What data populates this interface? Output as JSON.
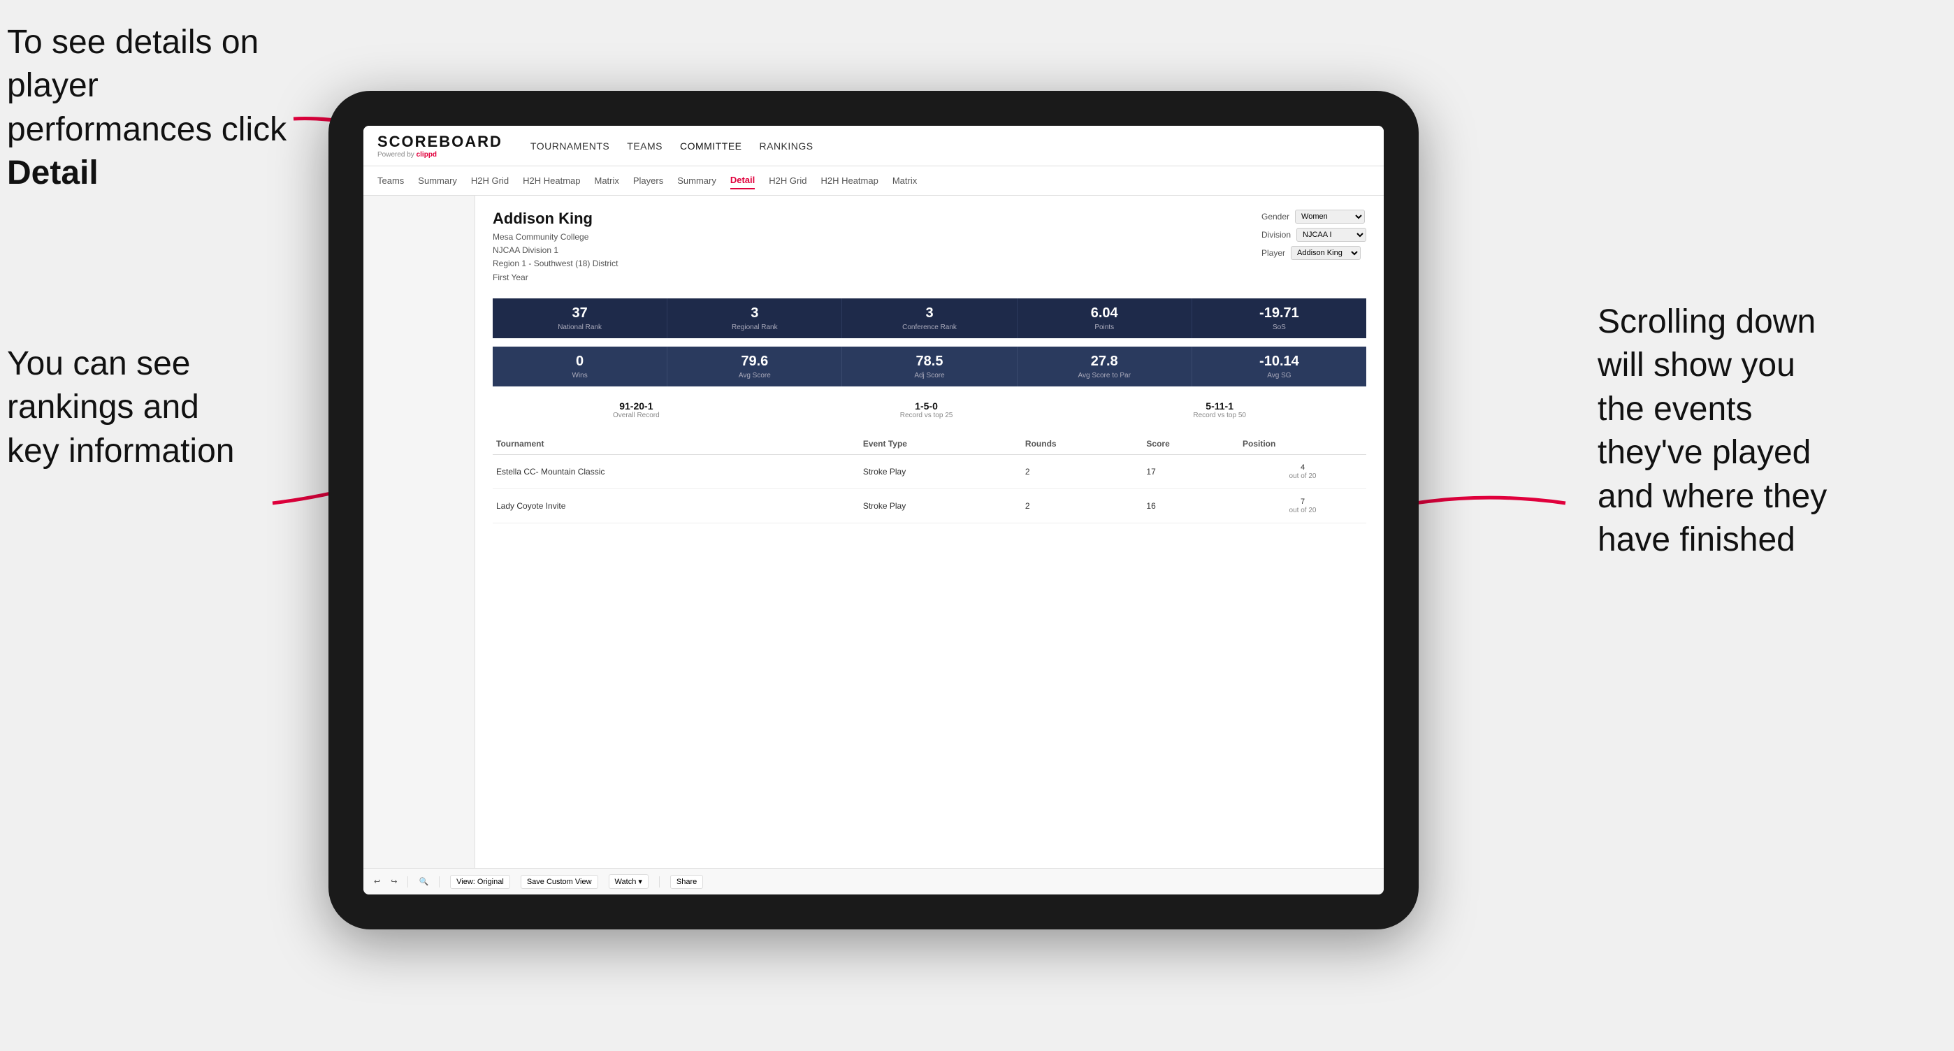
{
  "annotations": {
    "top_left": "To see details on player performances click ",
    "top_left_bold": "Detail",
    "bottom_left_line1": "You can see",
    "bottom_left_line2": "rankings and",
    "bottom_left_line3": "key information",
    "right_line1": "Scrolling down",
    "right_line2": "will show you",
    "right_line3": "the events",
    "right_line4": "they've played",
    "right_line5": "and where they",
    "right_line6": "have finished"
  },
  "nav": {
    "logo": "SCOREBOARD",
    "powered_by": "Powered by",
    "brand": "clippd",
    "items": [
      "TOURNAMENTS",
      "TEAMS",
      "COMMITTEE",
      "RANKINGS"
    ]
  },
  "sub_nav": {
    "items": [
      "Teams",
      "Summary",
      "H2H Grid",
      "H2H Heatmap",
      "Matrix",
      "Players",
      "Summary",
      "Detail",
      "H2H Grid",
      "H2H Heatmap",
      "Matrix"
    ],
    "active": "Detail"
  },
  "player": {
    "name": "Addison King",
    "school": "Mesa Community College",
    "division": "NJCAA Division 1",
    "region": "Region 1 - Southwest (18) District",
    "year": "First Year"
  },
  "filters": {
    "gender_label": "Gender",
    "gender_value": "Women",
    "division_label": "Division",
    "division_value": "NJCAA I",
    "player_label": "Player",
    "player_value": "Addison King"
  },
  "stats_row1": [
    {
      "value": "37",
      "label": "National Rank"
    },
    {
      "value": "3",
      "label": "Regional Rank"
    },
    {
      "value": "3",
      "label": "Conference Rank"
    },
    {
      "value": "6.04",
      "label": "Points"
    },
    {
      "value": "-19.71",
      "label": "SoS"
    }
  ],
  "stats_row2": [
    {
      "value": "0",
      "label": "Wins"
    },
    {
      "value": "79.6",
      "label": "Avg Score"
    },
    {
      "value": "78.5",
      "label": "Adj Score"
    },
    {
      "value": "27.8",
      "label": "Avg Score to Par"
    },
    {
      "value": "-10.14",
      "label": "Avg SG"
    }
  ],
  "records": [
    {
      "value": "91-20-1",
      "label": "Overall Record"
    },
    {
      "value": "1-5-0",
      "label": "Record vs top 25"
    },
    {
      "value": "5-11-1",
      "label": "Record vs top 50"
    }
  ],
  "table": {
    "headers": [
      "Tournament",
      "Event Type",
      "Rounds",
      "Score",
      "Position"
    ],
    "rows": [
      {
        "tournament": "Estella CC- Mountain Classic",
        "event_type": "Stroke Play",
        "rounds": "2",
        "score": "17",
        "position": "4\nout of 20"
      },
      {
        "tournament": "Lady Coyote Invite",
        "event_type": "Stroke Play",
        "rounds": "2",
        "score": "16",
        "position": "7\nout of 20"
      }
    ]
  },
  "toolbar": {
    "buttons": [
      "View: Original",
      "Save Custom View",
      "Watch ▾",
      "Share"
    ]
  }
}
